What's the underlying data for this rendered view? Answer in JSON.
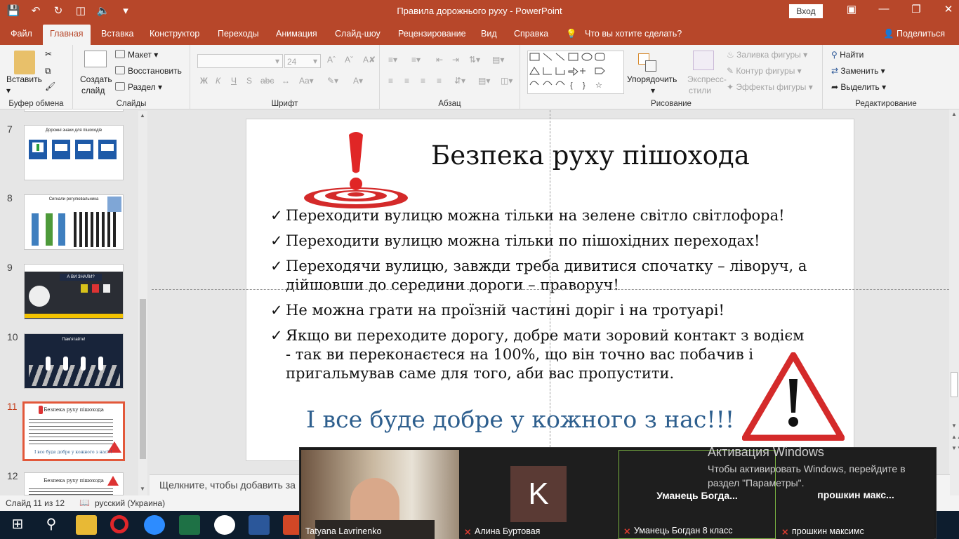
{
  "app": {
    "window_title": "Правила дорожнього руху - PowerPoint",
    "signin": "Вход",
    "qat_icons": [
      "save-icon",
      "undo-icon",
      "redo-icon",
      "present-icon",
      "audio-icon",
      "customize-icon"
    ]
  },
  "tabs": [
    "Файл",
    "Главная",
    "Вставка",
    "Конструктор",
    "Переходы",
    "Анимация",
    "Слайд-шоу",
    "Рецензирование",
    "Вид",
    "Справка",
    "Что вы хотите сделать?",
    "Поделиться"
  ],
  "ribbon": {
    "clipboard": {
      "paste": "Вставить",
      "label": "Буфер обмена"
    },
    "slides": {
      "new_slide_1": "Создать",
      "new_slide_2": "слайд",
      "layout": "Макет",
      "reset": "Восстановить",
      "section": "Раздел",
      "label": "Слайды"
    },
    "font": {
      "size": "24",
      "bold": "Ж",
      "italic": "К",
      "underline": "Ч",
      "strike": "S",
      "label": "Шрифт"
    },
    "paragraph": {
      "label": "Абзац"
    },
    "drawing": {
      "arrange": "Упорядочить",
      "quick_1": "Экспресс-",
      "quick_2": "стили",
      "fill": "Заливка фигуры",
      "outline": "Контур фигуры",
      "effects": "Эффекты фигуры",
      "label": "Рисование"
    },
    "editing": {
      "find": "Найти",
      "replace": "Заменить",
      "select": "Выделить",
      "label": "Редактирование"
    }
  },
  "thumbnails": [
    {
      "num": "7",
      "title": "Дорожні знаки для пішоходів"
    },
    {
      "num": "8",
      "title": "Сигнали регулювальника"
    },
    {
      "num": "9",
      "title": "А ВИ ЗНАЛИ?"
    },
    {
      "num": "10",
      "title": "Пам'ятайте!"
    },
    {
      "num": "11",
      "title": "Безпека руху пішохода",
      "closing": "І все буде добре у кожного з нас!!!"
    },
    {
      "num": "12",
      "title": "Безпека руху пішохода"
    }
  ],
  "slide": {
    "title": "Безпека руху пішохода",
    "bullets": [
      "Переходити вулицю можна тільки на зелене світло світлофора!",
      "Переходити вулицю можна тільки по пішохідних переходах!",
      "Переходячи вулицю, завжди треба дивитися спочатку – ліворуч, а дійшовши до середини дороги – праворуч!",
      "Не можна грати на проїзній частині доріг і на тротуарі!",
      "Якщо ви переходите дорогу, добре мати зоровий контакт з водієм - так ви переконаєтеся на 100%, що він точно вас побачив і пригальмував саме для того, аби вас пропустити."
    ],
    "closing": "І все буде добре у кожного з нас!!!"
  },
  "notes_placeholder": "Щелкните, чтобы добавить за",
  "status": {
    "slide_count": "Слайд 11 из 12",
    "language": "русский (Украина)"
  },
  "zoom": {
    "participants": [
      {
        "name": "Tatyana Lavrinenko"
      },
      {
        "name": "Алина Буртовая",
        "initial": "K"
      },
      {
        "name": "Уманець Богдан 8 класс",
        "display": "Уманець  Богда..."
      },
      {
        "name": "прошкин максимс",
        "display": "прошкин  макс..."
      }
    ]
  },
  "watermark": {
    "line1": "Активация Windows",
    "line2": "Чтобы активировать Windows, перейдите в раздел \"Параметры\"."
  },
  "colors": {
    "accent": "#b7472a",
    "closing_text": "#2e5f8e",
    "selected_thumb": "#e2583a"
  }
}
